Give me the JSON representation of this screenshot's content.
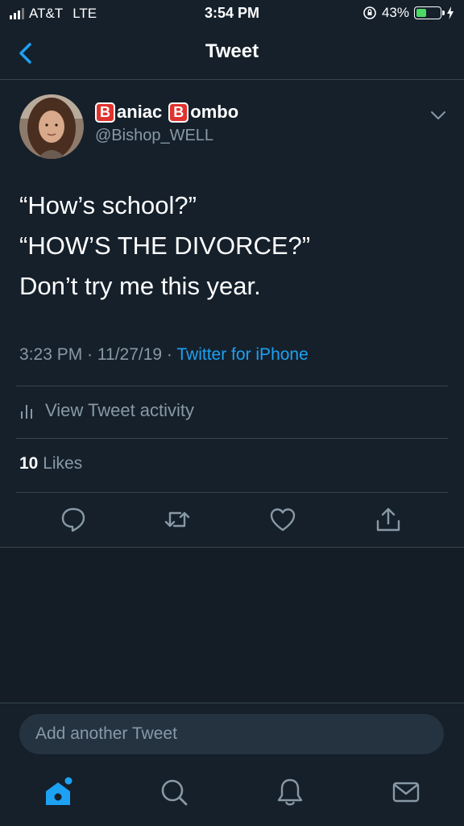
{
  "status_bar": {
    "carrier": "AT&T",
    "network": "LTE",
    "time": "3:54 PM",
    "battery_percent": "43%",
    "battery_level": 0.43
  },
  "nav": {
    "title": "Tweet"
  },
  "tweet": {
    "name_part1": "aniac",
    "name_part2": "ombo",
    "name_badge": "B",
    "handle": "@Bishop_WELL",
    "lines": [
      "“How’s school?”",
      "“HOW’S THE DIVORCE?”",
      "Don’t try me this year."
    ],
    "time": "3:23 PM",
    "date": "11/27/19",
    "source": "Twitter for iPhone",
    "separator": " · "
  },
  "activity": {
    "label": "View Tweet activity"
  },
  "likes": {
    "count": "10",
    "label": "Likes"
  },
  "composer": {
    "placeholder": "Add another Tweet"
  },
  "colors": {
    "background": "#15202b",
    "accent": "#1da1f2",
    "secondary_text": "#8899a6",
    "divider": "#38444d"
  }
}
